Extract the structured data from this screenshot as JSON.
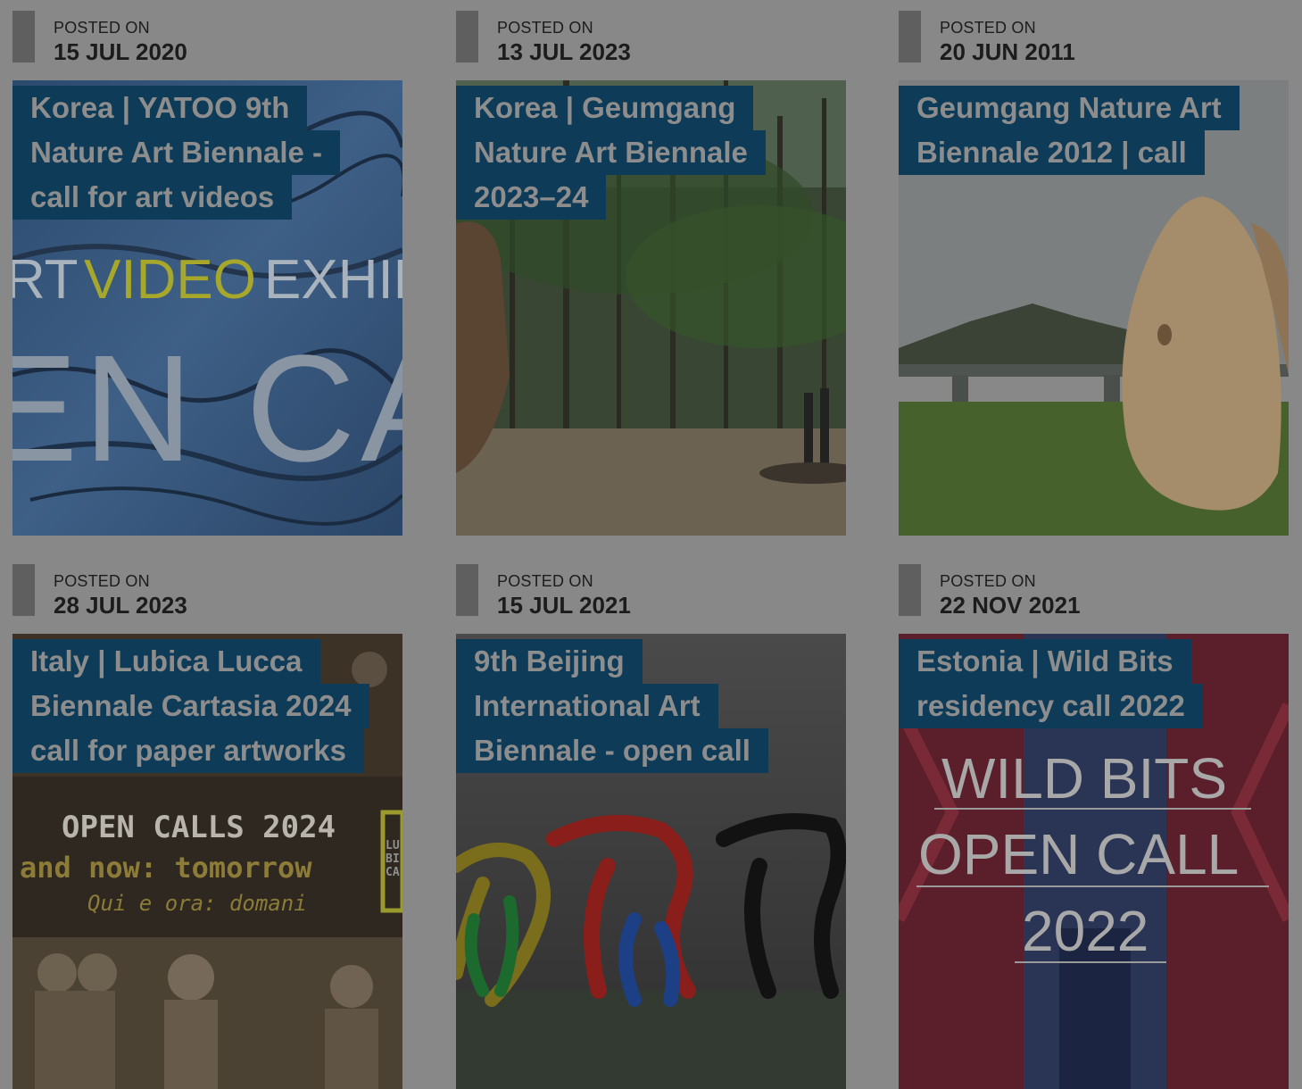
{
  "posted_label": "POSTED ON",
  "cards": [
    {
      "date": "15 JUL 2020",
      "title_lines": [
        "Korea | YATOO 9th",
        "Nature Art Biennale -",
        "call for art videos"
      ],
      "image": {
        "art_video": "RT",
        "video": "VIDEO",
        "exhib": "EXHIB",
        "big": "EN CA"
      }
    },
    {
      "date": "13 JUL 2023",
      "title_lines": [
        "Korea | Geumgang",
        "Nature Art Biennale",
        "2023–24"
      ]
    },
    {
      "date": "20 JUN 2011",
      "title_lines": [
        "Geumgang Nature Art",
        "Biennale 2012 | call"
      ]
    },
    {
      "date": "28 JUL 2023",
      "title_lines": [
        "Italy | Lubica Lucca",
        "Biennale Cartasia 2024",
        "call for paper artworks"
      ],
      "image": {
        "line1": "OPEN CALLS 2024",
        "line2": "and now: tomorrow",
        "line3": "Qui e ora: domani",
        "side": "LU BI CA"
      }
    },
    {
      "date": "15 JUL 2021",
      "title_lines": [
        "9th Beijing",
        "International Art",
        "Biennale - open call"
      ]
    },
    {
      "date": "22 NOV 2021",
      "title_lines": [
        "Estonia | Wild Bits",
        "residency call 2022"
      ],
      "image": {
        "line1": "WILD BITS",
        "line2": "OPEN CALL",
        "line3": "2022"
      }
    }
  ]
}
